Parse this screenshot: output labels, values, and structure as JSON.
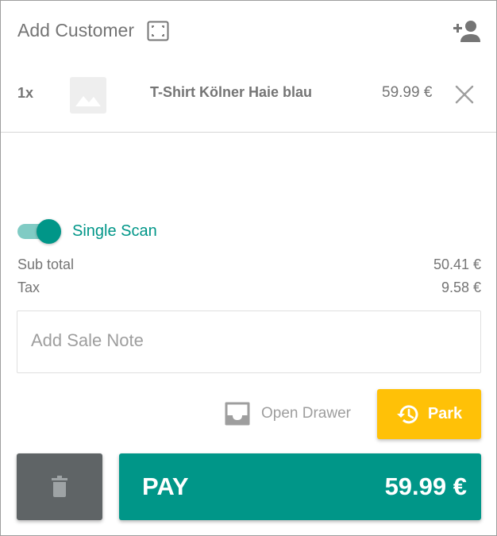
{
  "header": {
    "add_customer_label": "Add Customer",
    "scan_icon": "scan-frame-icon",
    "add_person_icon": "person-add-icon"
  },
  "cart": {
    "items": [
      {
        "qty": "1x",
        "name": "T-Shirt Kölner Haie blau",
        "price": "59.99 €",
        "image_icon": "image-placeholder-icon",
        "remove_icon": "close-icon"
      }
    ]
  },
  "single_scan": {
    "label": "Single Scan",
    "enabled": true
  },
  "totals": {
    "subtotal_label": "Sub total",
    "subtotal_value": "50.41 €",
    "tax_label": "Tax",
    "tax_value": "9.58 €"
  },
  "note": {
    "placeholder": "Add Sale Note",
    "value": ""
  },
  "actions": {
    "open_drawer_label": "Open Drawer",
    "park_label": "Park",
    "pay_label": "PAY",
    "pay_amount": "59.99 €"
  },
  "colors": {
    "accent": "#009688",
    "accent_light": "#80cbc4",
    "park": "#ffc107",
    "trash": "#5f6466",
    "text_muted": "#757575"
  }
}
